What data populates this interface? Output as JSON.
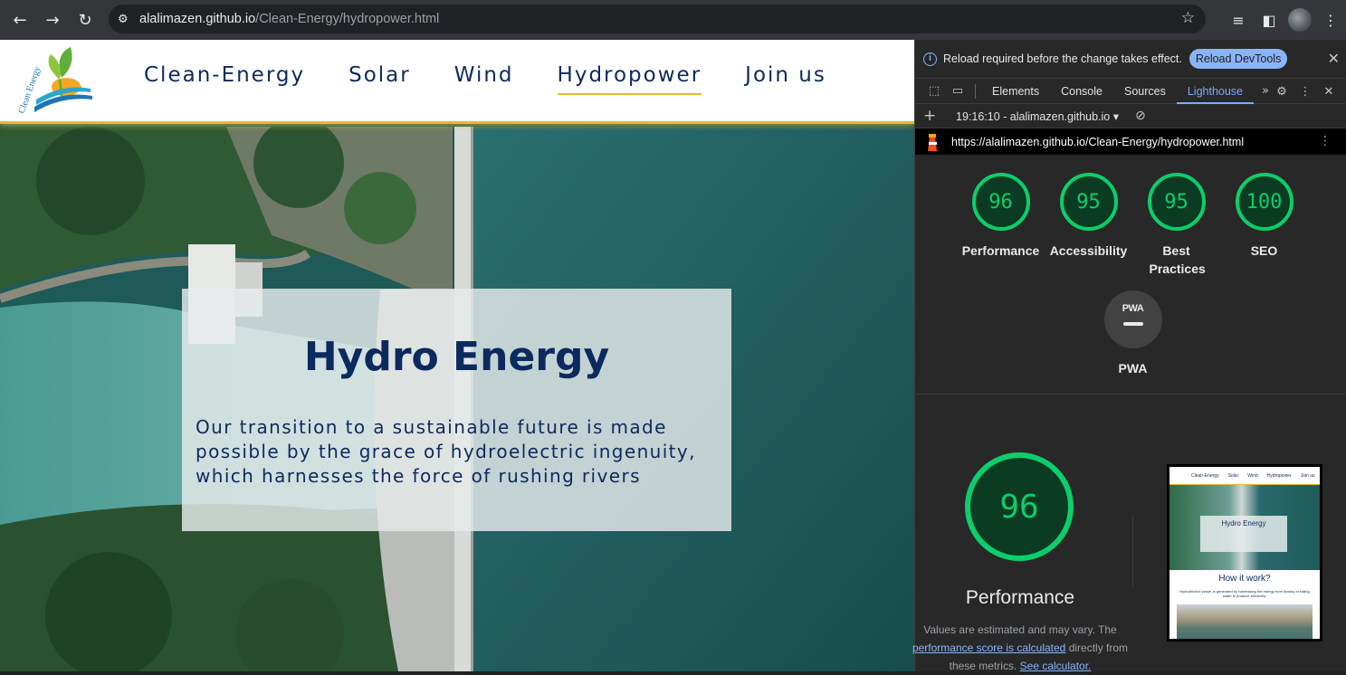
{
  "browser": {
    "url_host": "alalimazen.github.io",
    "url_path": "/Clean-Energy/hydropower.html"
  },
  "site": {
    "logo_text": "Clean Energy",
    "nav": [
      {
        "label": "Clean-Energy"
      },
      {
        "label": "Solar"
      },
      {
        "label": "Wind"
      },
      {
        "label": "Hydropower",
        "active": true
      },
      {
        "label": "Join us"
      }
    ],
    "hero": {
      "title": "Hydro Energy",
      "text": "Our transition to a sustainable future is made possible by the grace of hydroelectric ingenuity, which harnesses the force of rushing rivers"
    }
  },
  "devtools": {
    "info_message": "Reload required before the change takes effect.",
    "reload_label": "Reload DevTools",
    "tabs": [
      "Elements",
      "Console",
      "Sources",
      "Lighthouse"
    ],
    "active_tab": "Lighthouse",
    "report_select": "19:16:10 - alalimazen.github.io",
    "report_url": "https://alalimazen.github.io/Clean-Energy/hydropower.html",
    "scores": [
      {
        "value": "96",
        "label": "Performance"
      },
      {
        "value": "95",
        "label": "Accessibility"
      },
      {
        "value": "95",
        "label": "Best Practices"
      },
      {
        "value": "100",
        "label": "SEO"
      }
    ],
    "pwa": {
      "badge": "PWA",
      "label": "PWA"
    },
    "performance": {
      "score": "96",
      "label": "Performance",
      "note_prefix": "Values are estimated and may vary. The",
      "note_link": "performance score is calculated",
      "note_middle": "directly from these metrics.",
      "note_link2": "See calculator."
    },
    "thumbnail": {
      "nav": [
        "Clean-Energy",
        "Solar",
        "Wind",
        "Hydropower",
        "Join us"
      ],
      "title": "Hydro Energy",
      "heading": "How it work?",
      "paragraph": "Hydroelectric power is generated by harnessing the energy from flowing or falling water to produce electricity."
    },
    "colors": {
      "pass": "#0cce6b",
      "accent": "#7cacf8"
    }
  }
}
